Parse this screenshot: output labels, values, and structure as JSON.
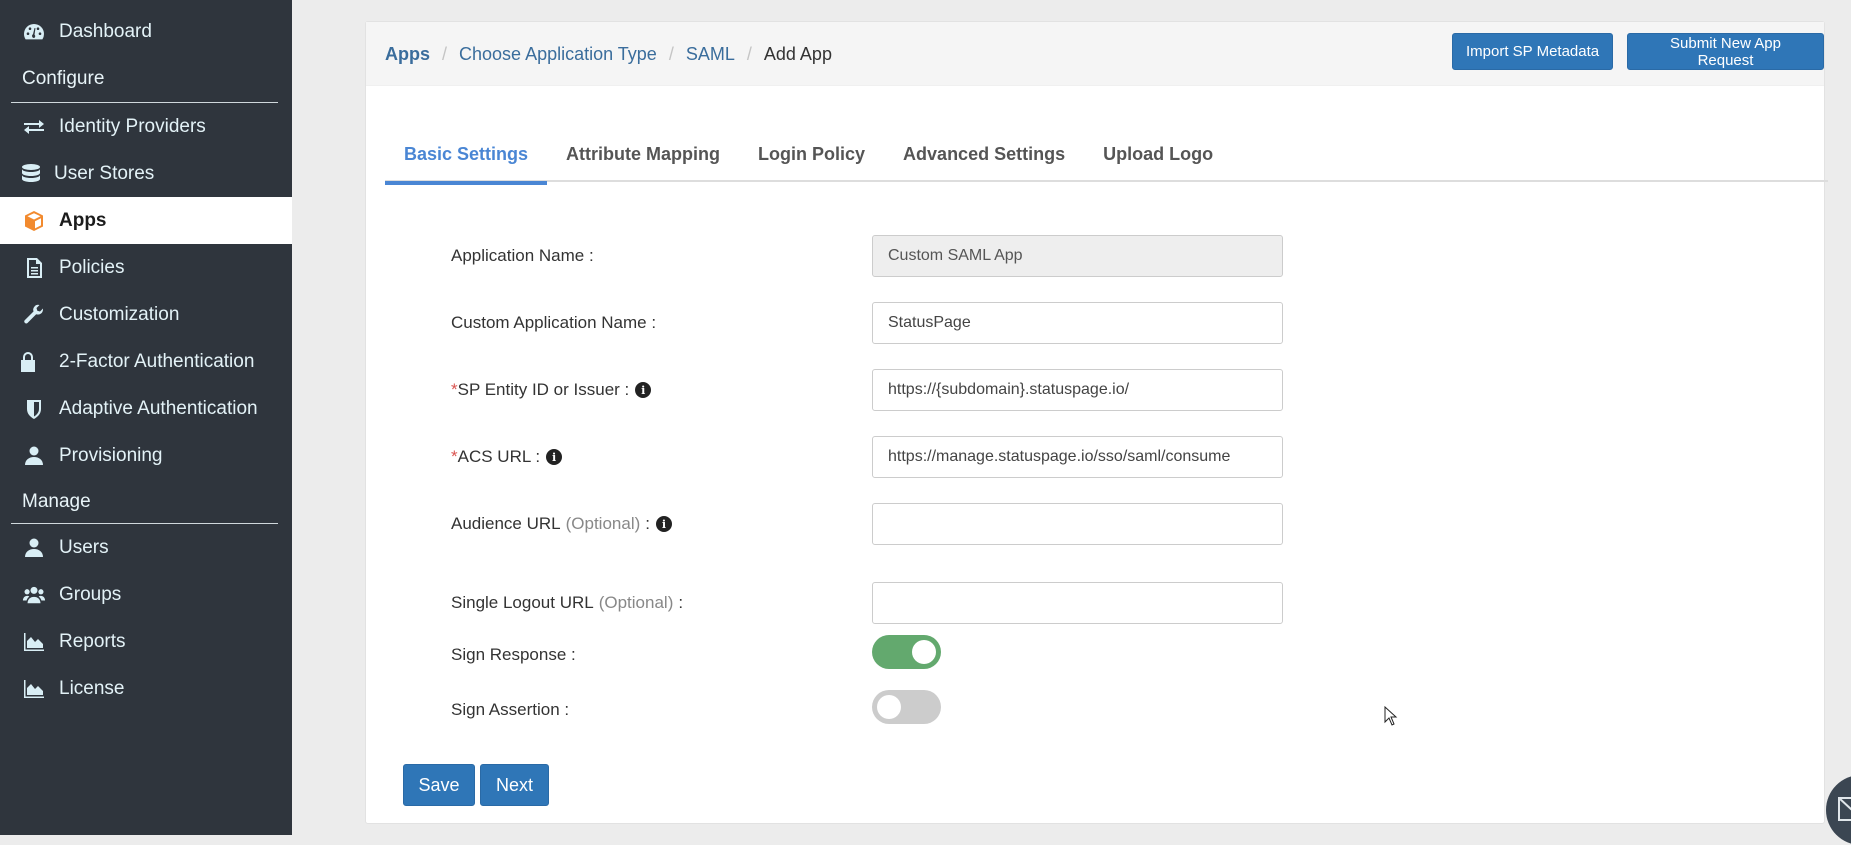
{
  "sidebar": {
    "items": [
      {
        "label": "Dashboard",
        "icon": "dashboard-icon"
      },
      {
        "label": "Identity Providers",
        "icon": "exchange-icon"
      },
      {
        "label": "User Stores",
        "icon": "database-icon"
      },
      {
        "label": "Apps",
        "icon": "cube-icon",
        "active": true
      },
      {
        "label": "Policies",
        "icon": "document-icon"
      },
      {
        "label": "Customization",
        "icon": "wrench-icon"
      },
      {
        "label": "2-Factor Authentication",
        "icon": "lock-icon"
      },
      {
        "label": "Adaptive Authentication",
        "icon": "shield-icon"
      },
      {
        "label": "Provisioning",
        "icon": "user-icon"
      },
      {
        "label": "Users",
        "icon": "user-icon"
      },
      {
        "label": "Groups",
        "icon": "users-icon"
      },
      {
        "label": "Reports",
        "icon": "area-chart-icon"
      },
      {
        "label": "License",
        "icon": "area-chart-icon"
      }
    ],
    "sections": {
      "configure": "Configure",
      "manage": "Manage"
    }
  },
  "breadcrumb": {
    "items": [
      "Apps",
      "Choose Application Type",
      "SAML",
      "Add App"
    ],
    "separator": "/"
  },
  "header": {
    "import_button": "Import SP Metadata",
    "submit_button": "Submit New App Request"
  },
  "tabs": [
    {
      "label": "Basic Settings",
      "active": true
    },
    {
      "label": "Attribute Mapping"
    },
    {
      "label": "Login Policy"
    },
    {
      "label": "Advanced Settings"
    },
    {
      "label": "Upload Logo"
    }
  ],
  "form": {
    "app_name": {
      "label": "Application Name :",
      "value": "Custom SAML App"
    },
    "custom_name": {
      "label": "Custom Application Name :",
      "value": "StatusPage"
    },
    "entity_id": {
      "required": "*",
      "label": "SP Entity ID or Issuer :",
      "value": "https://{subdomain}.statuspage.io/"
    },
    "acs_url": {
      "required": "*",
      "label": "ACS URL :",
      "value": "https://manage.statuspage.io/sso/saml/consume"
    },
    "audience_url": {
      "label": "Audience URL",
      "optional": "(Optional)",
      "suffix": ":",
      "value": ""
    },
    "logout_url": {
      "label": "Single Logout URL",
      "optional": "(Optional)",
      "suffix": ":",
      "value": ""
    },
    "sign_response": {
      "label": "Sign Response :",
      "on": true
    },
    "sign_assertion": {
      "label": "Sign Assertion :",
      "on": false
    },
    "info_glyph": "i"
  },
  "actions": {
    "save": "Save",
    "next": "Next"
  },
  "colors": {
    "primary": "#2f76b7",
    "active_tab": "#4a86d4",
    "toggle_on": "#63a96e",
    "sidebar_bg": "#2f353d",
    "apps_icon": "#f28a2e"
  }
}
